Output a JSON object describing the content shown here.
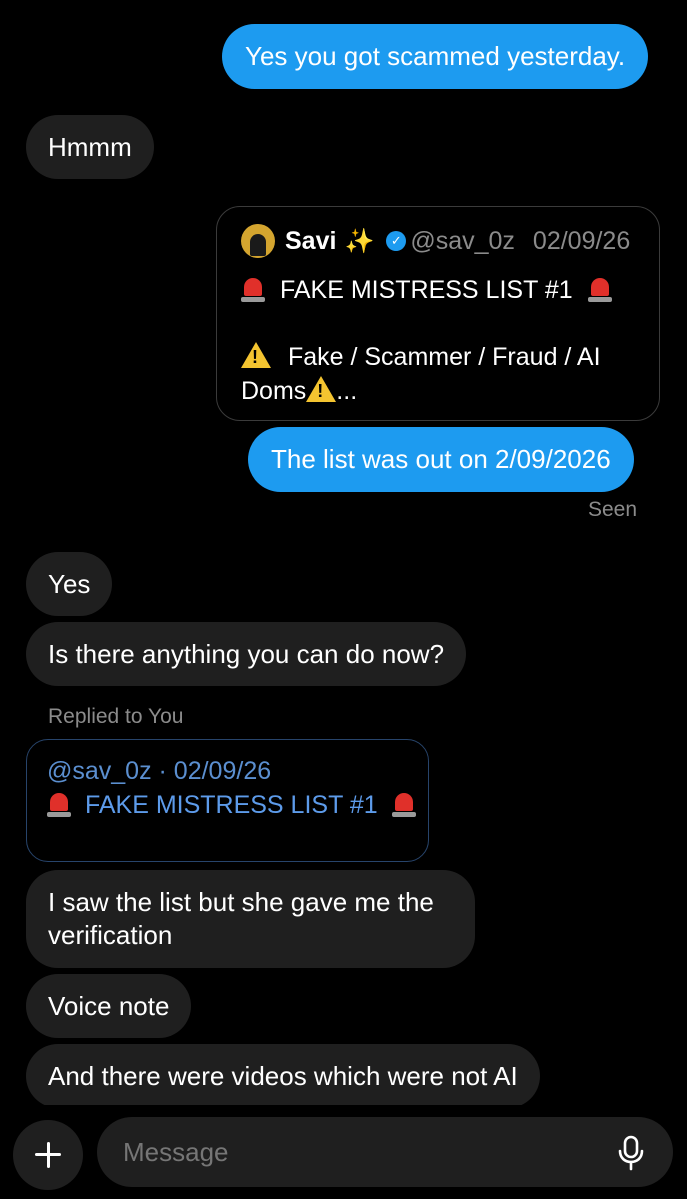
{
  "messages": {
    "m1": "Yes you got scammed yesterday.",
    "m2": "Hmmm",
    "m3": "The list was out on 2/09/2026",
    "m4": "Yes",
    "m5": "Is there anything you can do now?",
    "m6": "I saw the list but she gave me the verification",
    "m7": "Voice note",
    "m8": "And there were videos which were not AI"
  },
  "quoted_post": {
    "name": "Savi",
    "sparkle": "✨",
    "handle": "@sav_0z",
    "date": "02/09/26",
    "title": "FAKE MISTRESS LIST #1",
    "body_line1": "Fake / Scammer / Fraud / AI",
    "body_line2": "Doms",
    "body_ellipsis": "..."
  },
  "status": {
    "seen": "Seen"
  },
  "reply": {
    "label": "Replied to You",
    "meta": "@sav_0z · 02/09/26",
    "title": "FAKE MISTRESS LIST #1"
  },
  "composer": {
    "placeholder": "Message"
  },
  "icons": {
    "add": "plus-icon",
    "mic": "microphone-icon",
    "verified": "verified-badge-icon",
    "siren": "siren-emoji",
    "warning": "warning-emoji"
  },
  "colors": {
    "background": "#000000",
    "outgoing_bubble": "#1d9bf0",
    "incoming_bubble": "#1f1f1f",
    "muted_text": "#8b8b8b",
    "link_blue": "#5d9bea"
  }
}
